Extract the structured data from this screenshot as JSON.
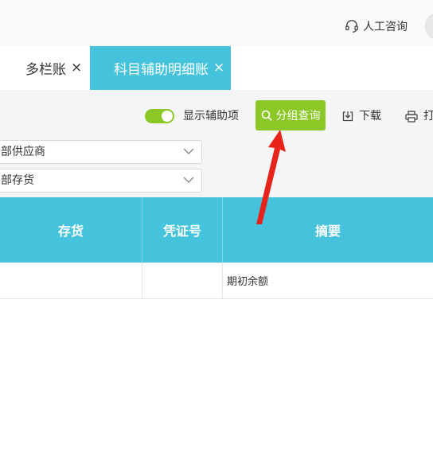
{
  "header": {
    "support_label": "人工咨询",
    "support_icon": "headset-icon"
  },
  "tabs": [
    {
      "label": "多栏账",
      "close": "×",
      "active": false
    },
    {
      "label": "科目辅助明细账",
      "close": "×",
      "active": true
    }
  ],
  "toolbar": {
    "toggle_label": "显示辅助项",
    "toggle_on": true,
    "group_query_label": "分组查询",
    "download_label": "下载",
    "print_label": "打"
  },
  "filters": {
    "supplier_value": "部供应商",
    "inventory_value": "部存货"
  },
  "table": {
    "columns": [
      "存货",
      "凭证号",
      "摘要"
    ],
    "rows": [
      {
        "inventory": "",
        "voucher_no": "",
        "summary": "期初余额"
      }
    ]
  },
  "colors": {
    "accent_cyan": "#45c3dc",
    "accent_green": "#8bc827",
    "annotation_red": "#e8231c"
  }
}
